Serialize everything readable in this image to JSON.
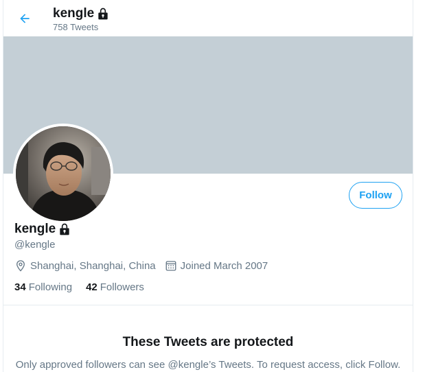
{
  "header": {
    "name": "kengle",
    "tweet_count": "758 Tweets"
  },
  "profile": {
    "name": "kengle",
    "handle": "@kengle",
    "location": "Shanghai, Shanghai, China",
    "joined": "Joined March 2007",
    "following_count": "34",
    "following_label": "Following",
    "followers_count": "42",
    "followers_label": "Followers",
    "protected_account": true
  },
  "actions": {
    "follow_label": "Follow"
  },
  "protected_notice": {
    "title": "These Tweets are protected",
    "text": "Only approved followers can see @kengle’s Tweets. To request access, click Follow."
  },
  "icons": {
    "back": "arrow-left-icon",
    "lock": "lock-icon",
    "location": "location-pin-icon",
    "calendar": "calendar-icon"
  },
  "colors": {
    "accent": "#1da1f2",
    "banner": "#c4cfd6",
    "secondary_text": "#657786",
    "primary_text": "#14171a"
  }
}
